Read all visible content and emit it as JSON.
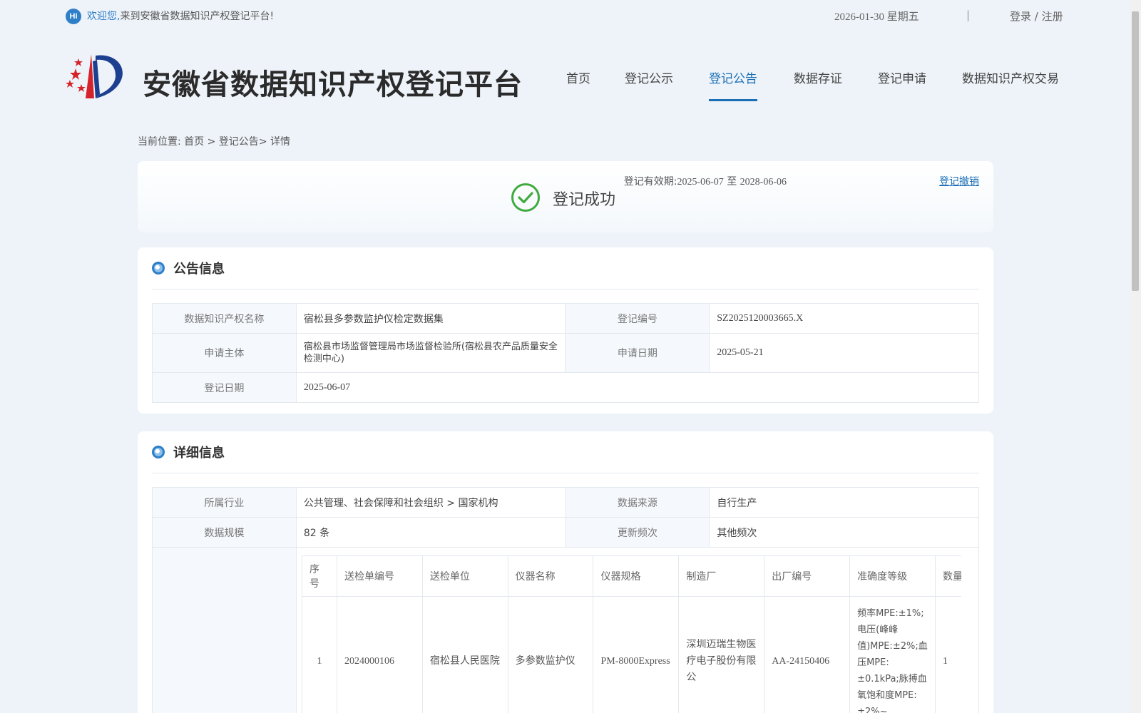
{
  "topbar": {
    "hi": "Hi",
    "welcome_prefix": "欢迎您,",
    "welcome_rest": "来到安徽省数据知识产权登记平台!",
    "date": "2026-01-30 星期五",
    "separator": "|",
    "login": "登录",
    "slash": "/",
    "register": "注册"
  },
  "site": {
    "title": "安徽省数据知识产权登记平台"
  },
  "nav": {
    "items": [
      {
        "label": "首页"
      },
      {
        "label": "登记公示"
      },
      {
        "label": "登记公告"
      },
      {
        "label": "数据存证"
      },
      {
        "label": "登记申请"
      },
      {
        "label": "数据知识产权交易"
      }
    ],
    "active_index": 2
  },
  "breadcrumb": {
    "prefix": "当前位置:",
    "home": "首页",
    "sep": ">",
    "section": "登记公告",
    "current": "> 详情"
  },
  "status": {
    "text": "登记成功",
    "validity_label": "登记有效期:",
    "validity_start": "2025-06-07",
    "validity_to": "至",
    "validity_end": "2028-06-06",
    "revoke": "登记撤销",
    "color": "#3fab3f"
  },
  "announcement": {
    "title": "公告信息",
    "rows": {
      "name_label": "数据知识产权名称",
      "name_value": "宿松县多参数监护仪检定数据集",
      "reg_no_label": "登记编号",
      "reg_no_value": "SZ2025120003665.X",
      "applicant_label": "申请主体",
      "applicant_value": "宿松县市场监督管理局市场监督检验所(宿松县农产品质量安全检测中心)",
      "apply_date_label": "申请日期",
      "apply_date_value": "2025-05-21",
      "reg_date_label": "登记日期",
      "reg_date_value": "2025-06-07"
    }
  },
  "details": {
    "title": "详细信息",
    "industry_label": "所属行业",
    "industry_value": "公共管理、社会保障和社会组织 > 国家机构",
    "source_label": "数据来源",
    "source_value": "自行生产",
    "scale_label": "数据规模",
    "scale_value": "82 条",
    "freq_label": "更新频次",
    "freq_value": "其他频次",
    "sample_table": {
      "headers": [
        "序号",
        "送检单编号",
        "送检单位",
        "仪器名称",
        "仪器规格",
        "制造厂",
        "出厂编号",
        "准确度等级",
        "数量"
      ],
      "row": [
        "1",
        "2024000106",
        "宿松县人民医院",
        "多参数监护仪",
        "PM-8000Express",
        "深圳迈瑞生物医疗电子股份有限公",
        "AA-24150406",
        "频率MPE:±1%;电压(峰峰值)MPE:±2%;血压MPE:±0.1kPa;脉搏血氧饱和度MPE:±2%~",
        "1"
      ]
    }
  },
  "colors": {
    "accent": "#1a6fb5",
    "background": "#eef3f9",
    "success": "#3fab3f"
  }
}
